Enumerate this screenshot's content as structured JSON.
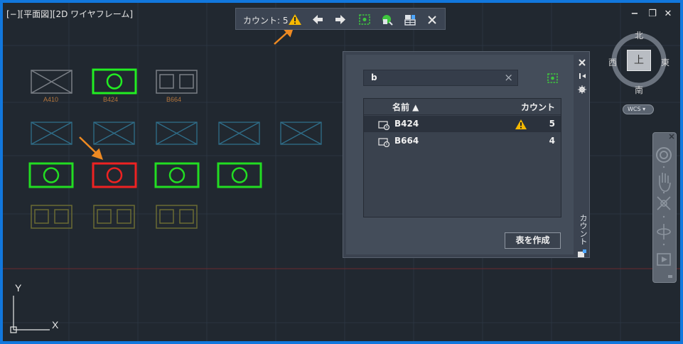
{
  "viewport": {
    "title": "[−][平面図][2D ワイヤフレーム]",
    "window_controls": [
      "−",
      "❐",
      "✕"
    ]
  },
  "toolbar": {
    "label": "カウント:",
    "count": "5",
    "buttons": [
      "warning-icon",
      "previous-arrow-icon",
      "next-arrow-icon",
      "zoom-selection-icon",
      "find-replace-icon",
      "insert-table-icon",
      "close-icon"
    ]
  },
  "blocks": {
    "row1_labels": [
      "A410",
      "B424",
      "B664"
    ]
  },
  "palette": {
    "search_value": "b",
    "columns": {
      "name": "名前 ▲",
      "count": "カウント"
    },
    "rows": [
      {
        "name": "B424",
        "count": "5",
        "warning": true,
        "selected": true
      },
      {
        "name": "B664",
        "count": "4",
        "warning": false,
        "selected": false
      }
    ],
    "create_table_label": "表を作成",
    "side_title": "カウント"
  },
  "viewcube": {
    "north": "北",
    "south": "南",
    "east": "東",
    "west": "西",
    "face": "上",
    "wcs": "WCS ▾"
  },
  "ucs": {
    "x": "X",
    "y": "Y"
  },
  "colors": {
    "background": "#212830",
    "border": "#1177dd",
    "palette": "#3b4350",
    "selected_row": "#2b323d",
    "highlight_green": "#22ee22",
    "highlight_red": "#ee2222",
    "warning": "#f5b800",
    "annotation_arrow": "#ee8a22"
  }
}
